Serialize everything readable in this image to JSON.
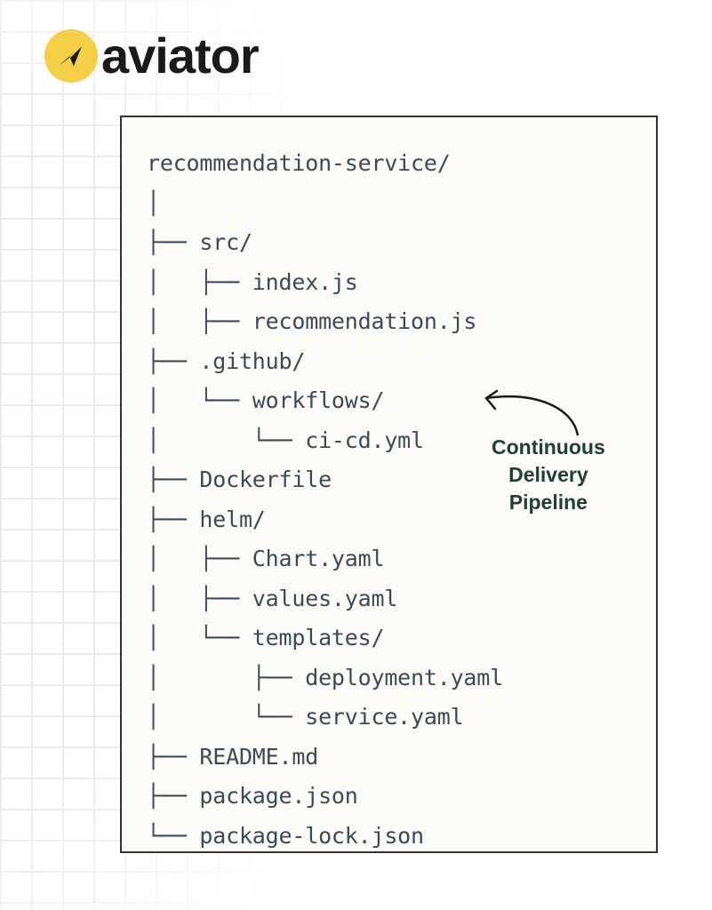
{
  "brand": {
    "name": "aviator",
    "accent": "#f5cf47"
  },
  "tree_lines": [
    "recommendation-service/",
    "│",
    "├── src/",
    "│   ├── index.js",
    "│   ├── recommendation.js",
    "├── .github/",
    "│   └── workflows/",
    "│       └── ci-cd.yml",
    "├── Dockerfile",
    "├── helm/",
    "│   ├── Chart.yaml",
    "│   ├── values.yaml",
    "│   └── templates/",
    "│       ├── deployment.yaml",
    "│       └── service.yaml",
    "├── README.md",
    "├── package.json",
    "└── package-lock.json"
  ],
  "annotation": {
    "line1": "Continuous",
    "line2": "Delivery",
    "line3": "Pipeline"
  }
}
